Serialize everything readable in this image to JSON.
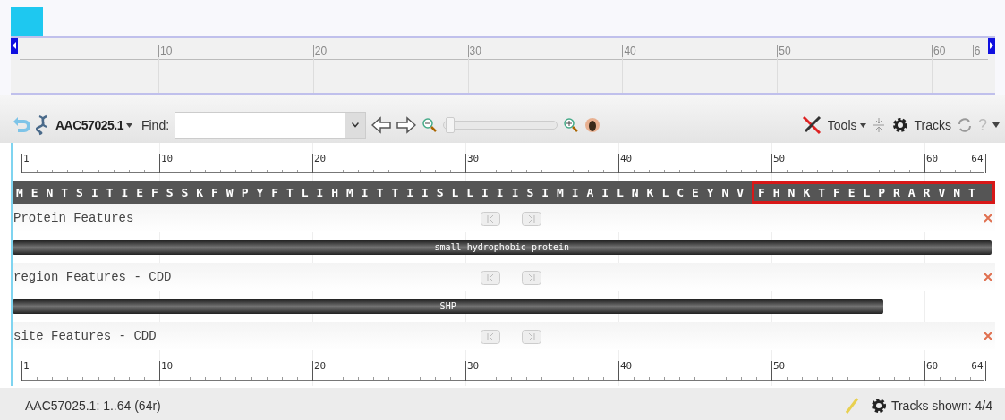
{
  "overview": {
    "ruler_labels": [
      "10",
      "20",
      "30",
      "40",
      "50",
      "60",
      "6"
    ]
  },
  "toolbar": {
    "zoom": {
      "level": 0
    },
    "sequence_id": "AAC57025.1",
    "find_label": "Find:",
    "tools": "Tools",
    "tracks": "Tracks",
    "help": "?"
  },
  "ruler_labels": [
    "1",
    "10",
    "20",
    "30",
    "40",
    "50",
    "60",
    "64"
  ],
  "sequence": [
    {
      "text": "MENTSITIEFSSKFWPYFTLIHMITTIISLLIIISIMIAILNKLCEYNV",
      "highlighted": false
    },
    {
      "text": "FHNKTFELPRARVNT",
      "highlighted": true
    }
  ],
  "tracks": [
    {
      "title": "Protein Features",
      "features": [
        {
          "label": "small hydrophobic protein",
          "level": 1
        }
      ]
    },
    {
      "title": "region Features - CDD",
      "features": [
        {
          "label": "SHP",
          "level": 0.89
        }
      ]
    },
    {
      "title": "site Features - CDD"
    }
  ],
  "bottom_ruler_labels": [
    "1",
    "10",
    "20",
    "30",
    "40",
    "50",
    "60",
    "64"
  ],
  "status_bar": {
    "location": "AAC57025.1: 1..64 (64r)",
    "tracks_shown": "Tracks shown: 4/4"
  }
}
